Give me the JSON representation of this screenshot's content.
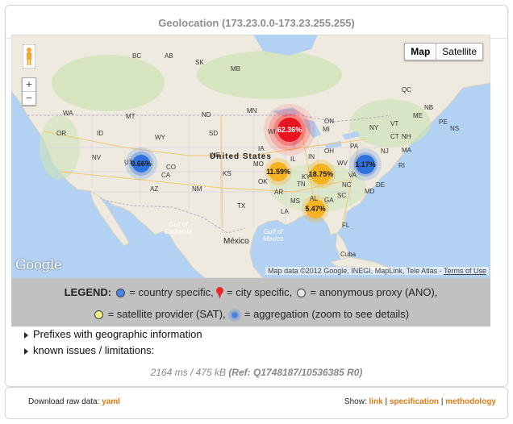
{
  "title": "Geolocation (173.23.0.0-173.23.255.255)",
  "map": {
    "maptype": {
      "map": "Map",
      "satellite": "Satellite"
    },
    "zoom": {
      "in": "+",
      "out": "−"
    },
    "logo": "Google",
    "attribution": "Map data ©2012 Google, INEGI, MapLink, Tele Atlas - ",
    "terms": "Terms of Use",
    "labels": {
      "united_states": "United States",
      "mexico": "México",
      "cuba": "Cuba",
      "gulf_california": "Gulf of\nCalifornia",
      "gulf_mexico": "Gulf of\nMexico",
      "states": [
        "BC",
        "AB",
        "SK",
        "MB",
        "WA",
        "MT",
        "ND",
        "MN",
        "OR",
        "ID",
        "WY",
        "SD",
        "WI",
        "MI",
        "NE",
        "IA",
        "IL",
        "IN",
        "OH",
        "PA",
        "NY",
        "NV",
        "UT",
        "CO",
        "KS",
        "MO",
        "KY",
        "WV",
        "VA",
        "MD",
        "NJ",
        "CT",
        "RI",
        "MA",
        "NH",
        "VT",
        "ME",
        "NB",
        "PE",
        "NS",
        "QC",
        "CA",
        "AZ",
        "NM",
        "OK",
        "AR",
        "TN",
        "NC",
        "SC",
        "GA",
        "AL",
        "MS",
        "LA",
        "TX",
        "FL",
        "ON",
        "DE"
      ]
    },
    "clusters": [
      {
        "label": "62.36%",
        "type": "city"
      },
      {
        "label": "0.66%",
        "type": "country"
      },
      {
        "label": "1.17%",
        "type": "country"
      },
      {
        "label": "11.59%",
        "type": "satellite"
      },
      {
        "label": "18.75%",
        "type": "satellite"
      },
      {
        "label": "5.47%",
        "type": "satellite"
      }
    ]
  },
  "legend": {
    "heading": "LEGEND:",
    "country": " = country specific,",
    "city": " = city specific,",
    "anon": " = anonymous proxy (ANO),",
    "satellite": " = satellite provider (SAT),",
    "aggregation": " = aggregation (zoom to see details)"
  },
  "expanders": [
    "Prefixes with geographic information",
    "known issues / limitations:"
  ],
  "timing": "2164 ms / 475 kB",
  "ref": "(Ref: Q1748187/10536385 R0)",
  "footer": {
    "download_label": "Download raw data:",
    "download_link": "yaml",
    "show_label": "Show:",
    "links": [
      "link",
      "specification",
      "methodology"
    ],
    "separator": "|"
  },
  "colors": {
    "country": "#3a7be0",
    "city": "#e8141f",
    "satellite": "#f5b324",
    "anon": "#e4e4e4",
    "accent": "#e07b1a"
  }
}
